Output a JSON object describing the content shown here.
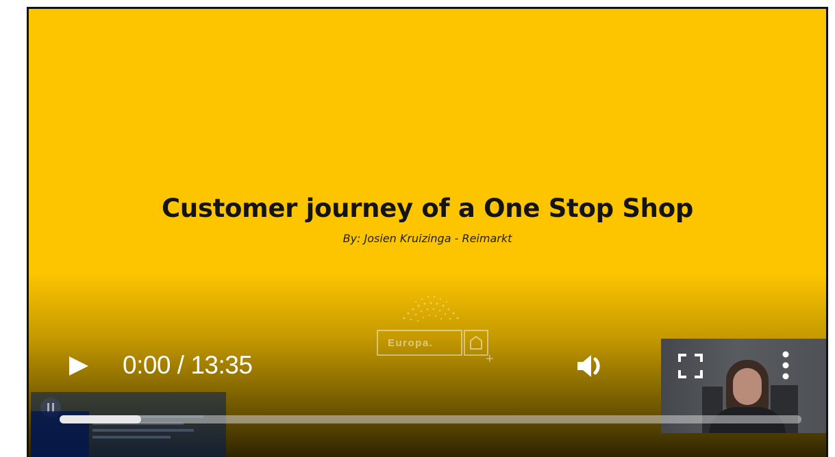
{
  "slide": {
    "title": "Customer journey of a One Stop Shop",
    "subtitle": "By: Josien Kruizinga - Reimarkt",
    "logo_text": "Europa.",
    "background_color": "#fdc500"
  },
  "controls": {
    "current_time": "0:00",
    "duration": "13:35",
    "time_display": "0:00 / 13:35",
    "progress_fraction": 0.11,
    "play_icon": "play-icon",
    "volume_icon": "volume-icon",
    "fullscreen_icon": "fullscreen-icon",
    "more_icon": "more-vertical-icon"
  }
}
